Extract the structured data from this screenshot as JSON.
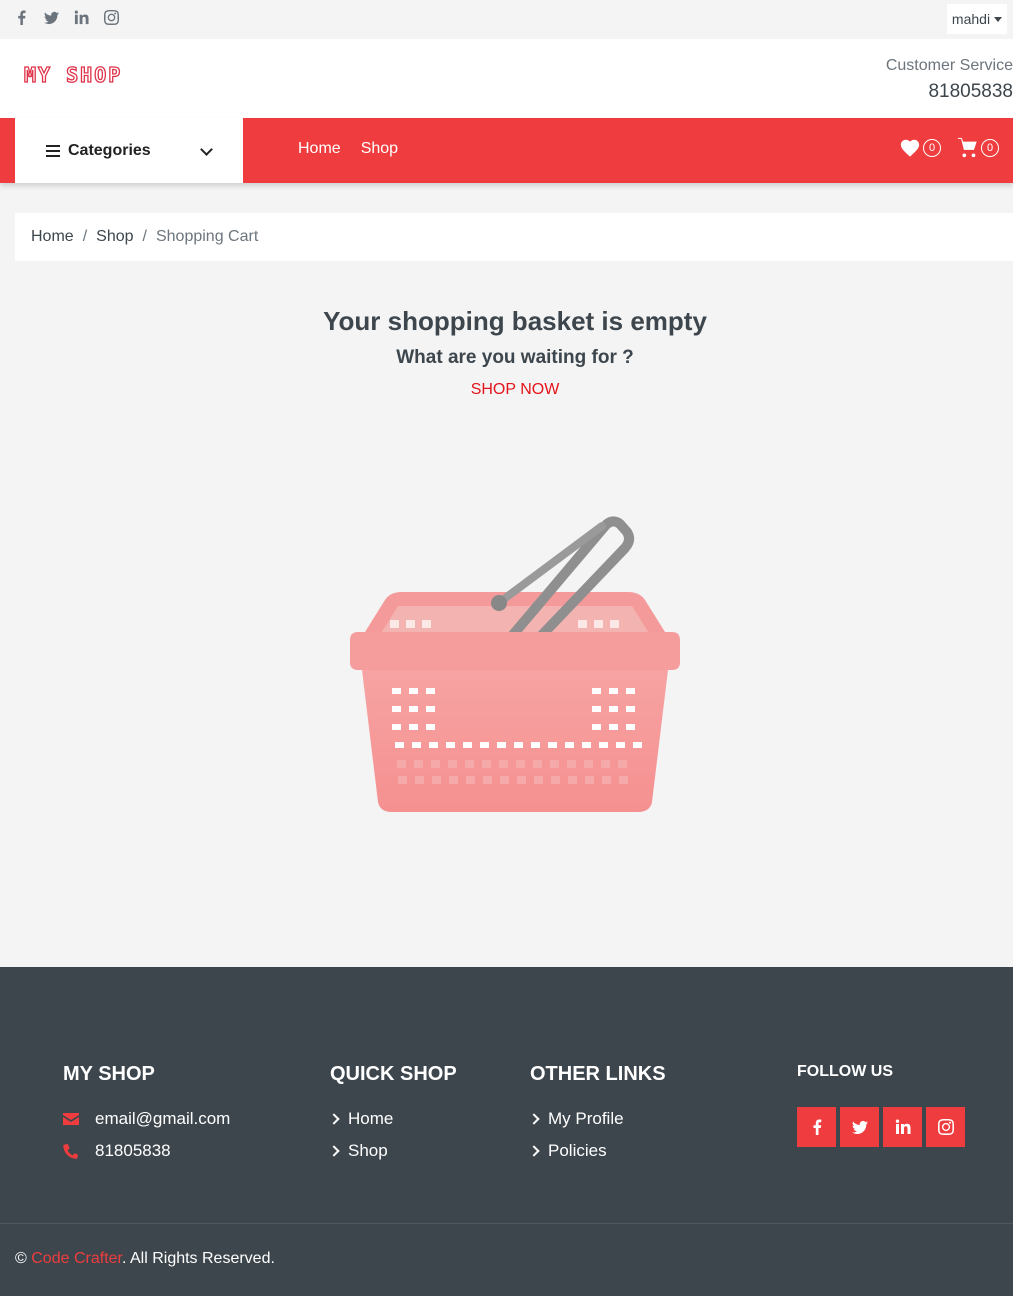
{
  "topbar": {
    "socials": [
      "facebook-icon",
      "twitter-icon",
      "linkedin-icon",
      "instagram-icon"
    ],
    "user": "mahdi"
  },
  "header": {
    "logo": "MY SHOP",
    "customer_service_label": "Customer Service",
    "customer_service_phone": "81805838"
  },
  "navbar": {
    "categories_label": "Categories",
    "links": [
      "Home",
      "Shop"
    ],
    "wishlist_count": "0",
    "cart_count": "0"
  },
  "breadcrumb": {
    "items": [
      "Home",
      "Shop",
      "Shopping Cart"
    ]
  },
  "empty_cart": {
    "title": "Your shopping basket is empty",
    "subtitle": "What are you waiting for ?",
    "cta": "SHOP NOW"
  },
  "footer": {
    "col1": {
      "title": "MY SHOP",
      "email": "email@gmail.com",
      "phone": "81805838"
    },
    "col2": {
      "title": "QUICK SHOP",
      "links": [
        "Home",
        "Shop"
      ]
    },
    "col3": {
      "title": "OTHER LINKS",
      "links": [
        "My Profile",
        "Policies"
      ]
    },
    "col4": {
      "title": "FOLLOW US"
    },
    "copyright_prefix": "©",
    "copyright_brand": "Code Crafter",
    "copyright_suffix": ". All Rights Reserved."
  },
  "colors": {
    "accent": "#ef3c3e",
    "dark": "#3d464d",
    "background": "#f4f4f4"
  }
}
